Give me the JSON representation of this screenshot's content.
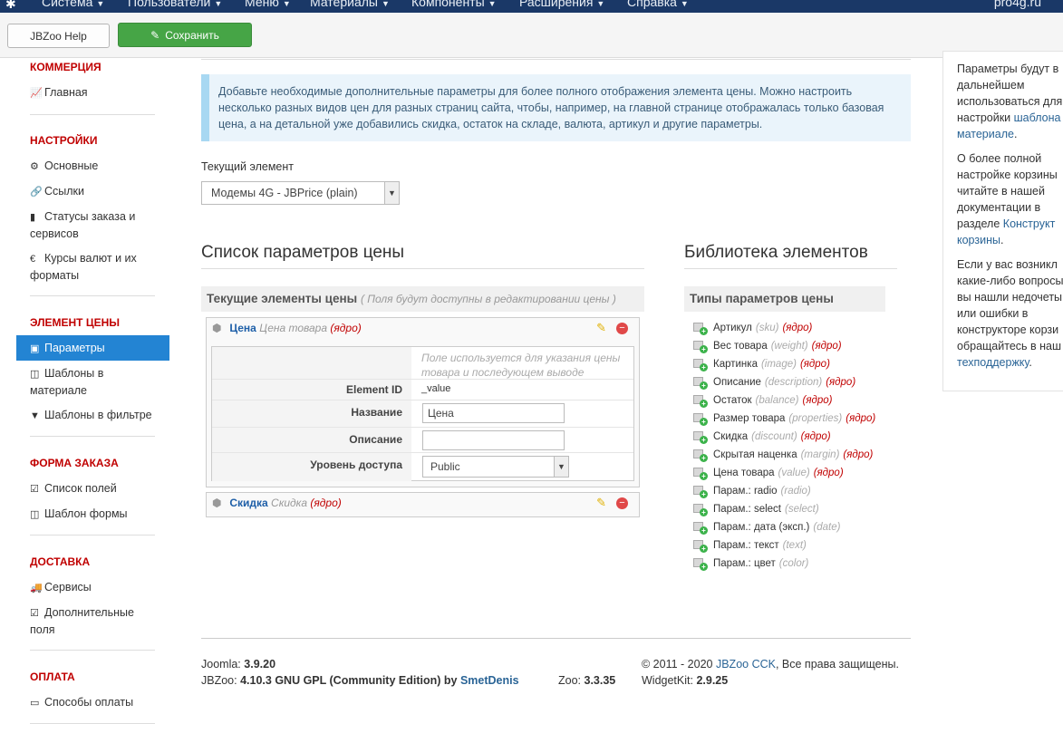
{
  "topnav": {
    "items": [
      "Система",
      "Пользователи",
      "Меню",
      "Материалы",
      "Компоненты",
      "Расширения",
      "Справка"
    ],
    "site": "pro4g.ru"
  },
  "toolbar": {
    "help_label": "JBZoo Help",
    "save_label": "Сохранить"
  },
  "sidebar": {
    "sections": [
      {
        "title": "КОММЕРЦИЯ",
        "items": [
          "Главная"
        ]
      },
      {
        "title": "НАСТРОЙКИ",
        "items": [
          "Основные",
          "Ссылки",
          "Статусы заказа и сервисов",
          "Курсы валют и их форматы"
        ]
      },
      {
        "title": "ЭЛЕМЕНТ ЦЕНЫ",
        "items": [
          "Параметры",
          "Шаблоны в материале",
          "Шаблоны в фильтре"
        ]
      },
      {
        "title": "ФОРМА ЗАКАЗА",
        "items": [
          "Список полей",
          "Шаблон формы"
        ]
      },
      {
        "title": "ДОСТАВКА",
        "items": [
          "Сервисы",
          "Дополнительные поля"
        ]
      },
      {
        "title": "ОПЛАТА",
        "items": [
          "Способы оплаты"
        ]
      }
    ]
  },
  "info": {
    "text": "Добавьте необходимые дополнительные параметры для более полного отображения элемента цены. Можно настроить несколько разных видов цен для разных страниц сайта, чтобы, например, на главной странице отображалась только базовая цена, а на детальной уже добавились скидка, остаток на складе, валюта, артикул и другие параметры."
  },
  "current_element": {
    "label": "Текущий элемент",
    "value": "Модемы 4G - JBPrice (plain)"
  },
  "params": {
    "title": "Список параметров цены",
    "subhead": "Текущие элементы цены",
    "subhead_hint": "( Поля будут доступны в редактировании цены )",
    "elements": [
      {
        "name": "Цена",
        "desc": "Цена товара",
        "core": "(ядро)"
      },
      {
        "name": "Скидка",
        "desc": "Скидка",
        "core": "(ядро)"
      }
    ],
    "table": {
      "hint": "Поле используется для указания цены товара и последующем выводе",
      "id_label": "Element ID",
      "id_value": "_value",
      "name_label": "Название",
      "name_value": "Цена",
      "desc_label": "Описание",
      "desc_value": "",
      "access_label": "Уровень доступа",
      "access_value": "Public"
    }
  },
  "library": {
    "title": "Библиотека элементов",
    "subhead": "Типы параметров цены",
    "items": [
      {
        "name": "Артикул",
        "alias": "(sku)",
        "core": "(ядро)"
      },
      {
        "name": "Вес товара",
        "alias": "(weight)",
        "core": "(ядро)"
      },
      {
        "name": "Картинка",
        "alias": "(image)",
        "core": "(ядро)"
      },
      {
        "name": "Описание",
        "alias": "(description)",
        "core": "(ядро)"
      },
      {
        "name": "Остаток",
        "alias": "(balance)",
        "core": "(ядро)"
      },
      {
        "name": "Размер товара",
        "alias": "(properties)",
        "core": "(ядро)"
      },
      {
        "name": "Скидка",
        "alias": "(discount)",
        "core": "(ядро)"
      },
      {
        "name": "Скрытая наценка",
        "alias": "(margin)",
        "core": "(ядро)"
      },
      {
        "name": "Цена товара",
        "alias": "(value)",
        "core": "(ядро)"
      },
      {
        "name": "Парам.: radio",
        "alias": "(radio)",
        "core": ""
      },
      {
        "name": "Парам.: select",
        "alias": "(select)",
        "core": ""
      },
      {
        "name": "Парам.: дата (эксп.)",
        "alias": "(date)",
        "core": ""
      },
      {
        "name": "Парам.: текст",
        "alias": "(text)",
        "core": ""
      },
      {
        "name": "Парам.: цвет",
        "alias": "(color)",
        "core": ""
      }
    ]
  },
  "footer": {
    "joomla_label": "Joomla:",
    "joomla_version": "3.9.20",
    "jbzoo_label": "JBZoo:",
    "jbzoo_version": "4.10.3 GNU GPL (Community Edition) by",
    "author": "SmetDenis",
    "zoo_label": "Zoo:",
    "zoo_version": "3.3.35",
    "copyright_pre": "© 2011 - 2020",
    "copyright_link": "JBZoo CCK",
    "copyright_post": ", Все права защищены.",
    "widgetkit_label": "WidgetKit:",
    "widgetkit_version": "2.9.25"
  },
  "right_panel": {
    "p1_lines": [
      "Параметры будут в",
      "дальнейшем",
      "использоваться для",
      "настройки "
    ],
    "p1_link1": "шаблона",
    "p1_link2": "материале",
    "p2_lines": [
      "О более полной",
      "настройке корзины",
      "читайте в нашей",
      "документации в",
      "разделе "
    ],
    "p2_link1": "Конструкт",
    "p2_link2": "корзины",
    "p3_lines": [
      "Если у вас возникл",
      "какие-либо вопросы",
      "вы нашли недочеты",
      "или ошибки в",
      "конструкторе корзи",
      "обращайтесь в наш"
    ],
    "p3_link": "техподдержку"
  }
}
